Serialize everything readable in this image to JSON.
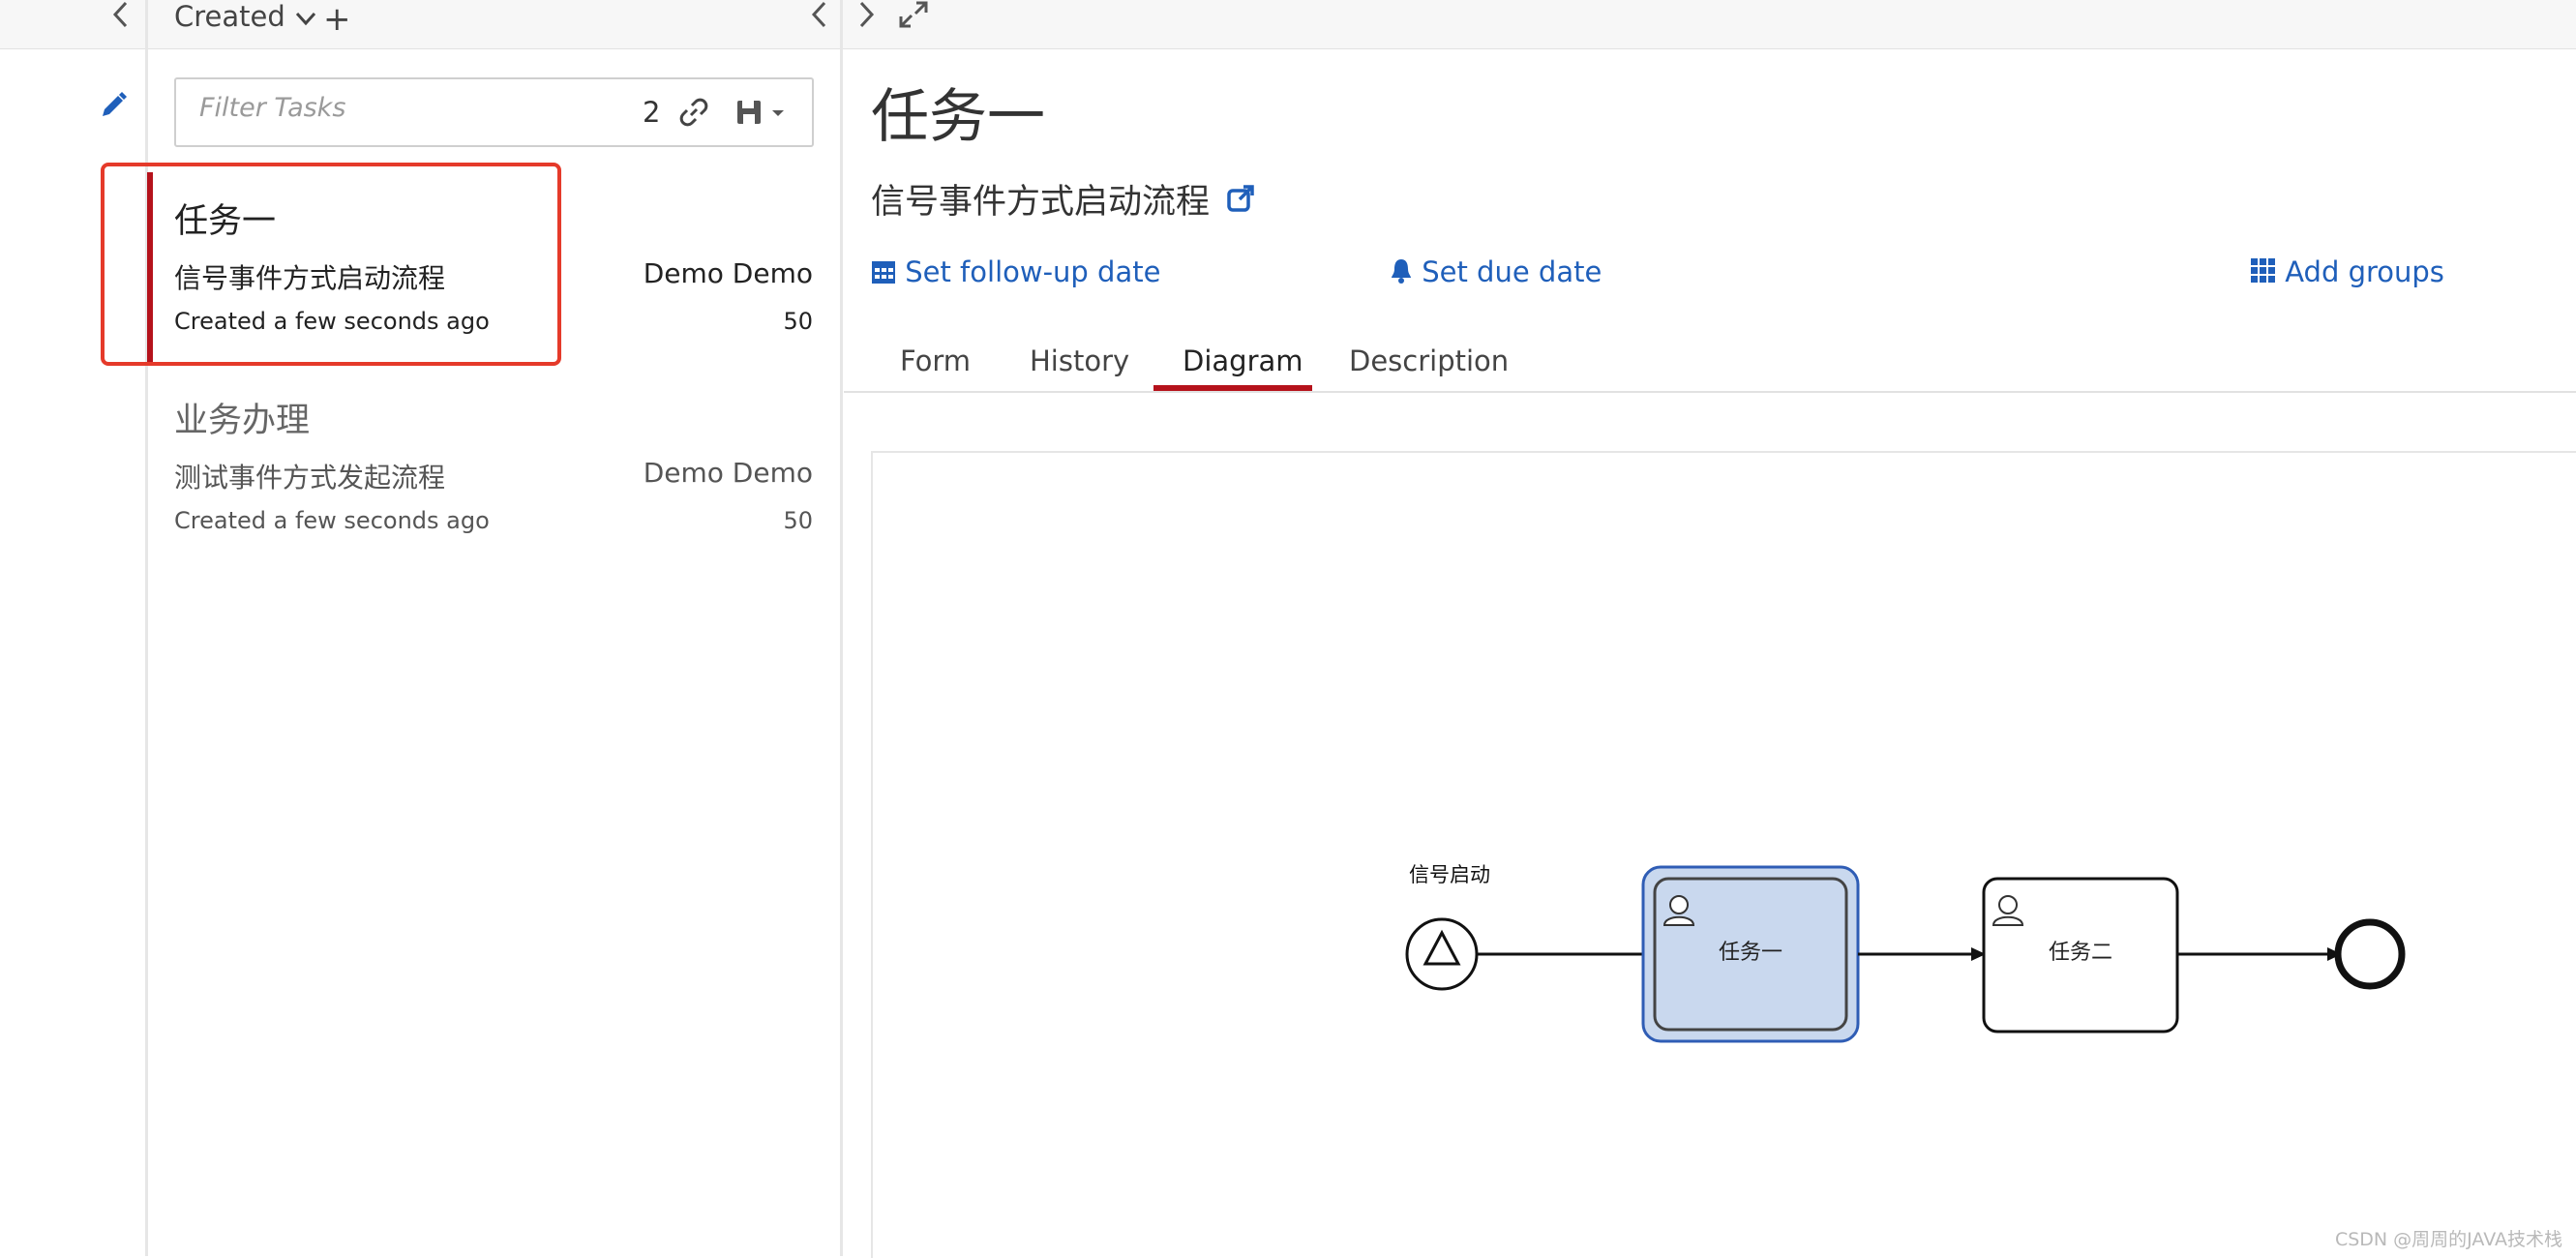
{
  "list_header": {
    "sort_label": "Created",
    "add_symbol": "+"
  },
  "filter": {
    "placeholder": "Filter Tasks",
    "count": "2"
  },
  "tasks": [
    {
      "name": "任务一",
      "process": "信号事件方式启动流程",
      "assignee": "Demo Demo",
      "created": "Created a few seconds ago",
      "priority": "50"
    },
    {
      "name": "业务办理",
      "process": "测试事件方式发起流程",
      "assignee": "Demo Demo",
      "created": "Created a few seconds ago",
      "priority": "50"
    }
  ],
  "detail": {
    "title": "任务一",
    "process_name": "信号事件方式启动流程",
    "actions": {
      "follow_up": "Set follow-up date",
      "due": "Set due date",
      "groups": "Add groups"
    },
    "tabs": [
      "Form",
      "History",
      "Diagram",
      "Description"
    ],
    "active_tab": "Diagram"
  },
  "diagram": {
    "start_event_label": "信号启动",
    "task1_label": "任务一",
    "task2_label": "任务二"
  },
  "watermark": "CSDN @周周的JAVA技术栈",
  "colors": {
    "accent_red": "#b5121b",
    "link_blue": "#1f5fba",
    "highlight_red": "#e53a2a",
    "active_task_fill": "#c9d8ee"
  },
  "icons": [
    "chevron-left-icon",
    "chevron-down-icon",
    "plus-icon",
    "chevron-right-icon",
    "expand-icon",
    "pencil-icon",
    "link-icon",
    "save-icon",
    "external-link-icon",
    "calendar-icon",
    "bell-icon",
    "grid-icon",
    "user-icon"
  ]
}
